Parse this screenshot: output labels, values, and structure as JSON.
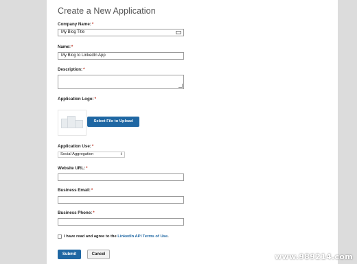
{
  "page": {
    "title": "Create a New Application"
  },
  "fields": {
    "company_name": {
      "label": "Company Name:",
      "required": "*",
      "value": "My Blog Title"
    },
    "name": {
      "label": "Name:",
      "required": "*",
      "value": "My Blog to LinkedIn App"
    },
    "description": {
      "label": "Description:",
      "required": "*",
      "value": ""
    },
    "application_logo": {
      "label": "Application Logo:",
      "required": "*",
      "upload_button": "Select File to Upload"
    },
    "application_use": {
      "label": "Application Use:",
      "required": "*",
      "selected": "Social Aggregation"
    },
    "website_url": {
      "label": "Website URL:",
      "required": "*",
      "value": ""
    },
    "business_email": {
      "label": "Business Email:",
      "required": "*",
      "value": ""
    },
    "business_phone": {
      "label": "Business Phone:",
      "required": "*",
      "value": ""
    }
  },
  "terms": {
    "prefix": "I have read and agree to the ",
    "link": "LinkedIn API Terms of Use",
    "suffix": "."
  },
  "buttons": {
    "submit": "Submit",
    "cancel": "Cancel"
  },
  "watermark": "www.989214.com",
  "colors": {
    "accent": "#1f67a3",
    "required": "#c0392b",
    "background": "#dcdcdc"
  }
}
